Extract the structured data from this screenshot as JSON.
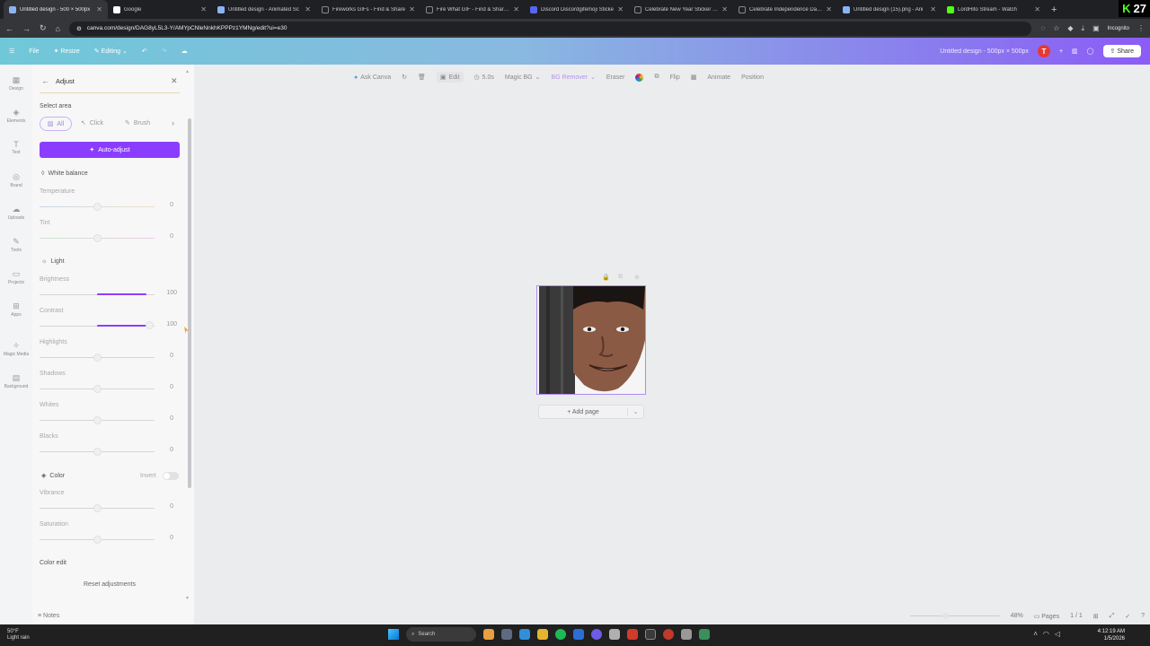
{
  "browser": {
    "tabs": [
      {
        "title": "Untitled design - 500 × 500px",
        "active": true
      },
      {
        "title": "Google"
      },
      {
        "title": "Untitled design - Animated Sc"
      },
      {
        "title": "Fireworks GIFs - Find & Share"
      },
      {
        "title": "Fire What GIF - Find & Share o"
      },
      {
        "title": "Discord Discordgifemoji Sticke"
      },
      {
        "title": "Celebrate New Year Sticker by"
      },
      {
        "title": "Celebrate Independence Day S"
      },
      {
        "title": "Untitled design (15).png - Ani"
      },
      {
        "title": "LordHito Stream - Watch"
      }
    ],
    "newtab": "+",
    "url": "canva.com/design/DAG8yL5L3-Y/AMYpCNleNnkhKPPPz1YMNg/edit?ui=e30",
    "incognito": "Incognito",
    "k_number": "27"
  },
  "header": {
    "file": "File",
    "resize": "Resize",
    "editing": "Editing",
    "design_title": "Untitled design - 500px × 500px",
    "avatar": "T",
    "share": "Share"
  },
  "rail": [
    "Design",
    "Elements",
    "Text",
    "Brand",
    "Uploads",
    "Tools",
    "Projects",
    "Apps",
    "Magic Media",
    "Background"
  ],
  "panel": {
    "title": "Adjust",
    "select_area": "Select area",
    "seg_all": "All",
    "seg_click": "Click",
    "seg_brush": "Brush",
    "auto_adjust": "Auto-adjust",
    "white_balance": "White balance",
    "light": "Light",
    "color": "Color",
    "invert": "Invert",
    "color_edit": "Color edit",
    "reset": "Reset adjustments",
    "sliders": {
      "temperature": {
        "label": "Temperature",
        "value": "0"
      },
      "tint": {
        "label": "Tint",
        "value": "0"
      },
      "brightness": {
        "label": "Brightness",
        "value": "100"
      },
      "contrast": {
        "label": "Contrast",
        "value": "100"
      },
      "highlights": {
        "label": "Highlights",
        "value": "0"
      },
      "shadows": {
        "label": "Shadows",
        "value": "0"
      },
      "whites": {
        "label": "Whites",
        "value": "0"
      },
      "blacks": {
        "label": "Blacks",
        "value": "0"
      },
      "vibrance": {
        "label": "Vibrance",
        "value": "0"
      },
      "saturation": {
        "label": "Saturation",
        "value": "0"
      }
    }
  },
  "toolbar": {
    "ask_canva": "Ask Canva",
    "edit": "Edit",
    "duration": "5.0s",
    "magic_bg": "Magic BG",
    "bg_remover": "BG Remover",
    "eraser": "Eraser",
    "flip": "Flip",
    "animate": "Animate",
    "position": "Position"
  },
  "canvas": {
    "add_page": "+ Add page"
  },
  "status": {
    "notes": "Notes",
    "zoom": "48%",
    "pages": "Pages",
    "page_count": "1 / 1"
  },
  "taskbar": {
    "temp": "50°F",
    "weather": "Light rain",
    "search": "Search",
    "time": "4:12:19 AM",
    "date": "1/5/2026"
  }
}
